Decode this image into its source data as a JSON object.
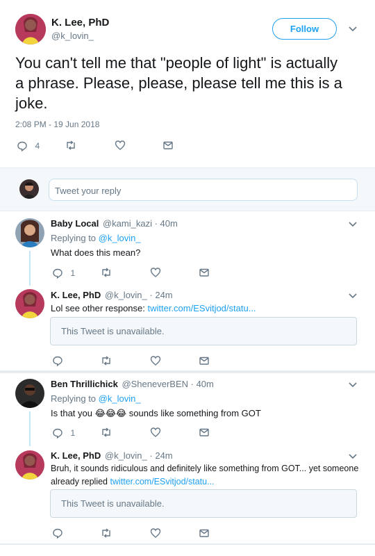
{
  "main_tweet": {
    "name": "K. Lee, PhD",
    "handle": "@k_lovin_",
    "follow_label": "Follow",
    "text": "You can't tell me that \"people of light\" is actually a phrase. Please, please, please tell me this is a joke.",
    "timestamp": "2:08 PM - 19 Jun 2018",
    "reply_count": "4"
  },
  "reply_box": {
    "placeholder": "Tweet your reply"
  },
  "replies": [
    {
      "name": "Baby Local",
      "handle": "@kami_kazi",
      "time": "· 40m",
      "replying_prefix": "Replying to ",
      "replying_to": "@k_lovin_",
      "text": "What does this mean?",
      "reply_count": "1"
    },
    {
      "name": "K. Lee, PhD",
      "handle": "@k_lovin_",
      "time": "· 24m",
      "text": "Lol see other response: ",
      "link": "twitter.com/ESvitjod/statu...",
      "unavailable": "This Tweet is unavailable."
    },
    {
      "name": "Ben Thrillichick",
      "handle": "@SheneverBEN",
      "time": "· 40m",
      "replying_prefix": "Replying to ",
      "replying_to": "@k_lovin_",
      "text_before": "Is that you ",
      "emoji": "😂😂😂",
      "text_after": " sounds like something from GOT",
      "reply_count": "1"
    },
    {
      "name": "K. Lee, PhD",
      "handle": "@k_lovin_",
      "time": "· 24m",
      "text_line1": "Bruh, it sounds ridiculous and definitely like something from GOT... yet someone",
      "text_line2": "already replied ",
      "link": "twitter.com/ESvitjod/statu...",
      "unavailable": "This Tweet is unavailable."
    }
  ],
  "colors": {
    "accent": "#1da1f2",
    "thread_line": "#c4e6fb",
    "text": "#14171a",
    "secondary": "#657786"
  }
}
